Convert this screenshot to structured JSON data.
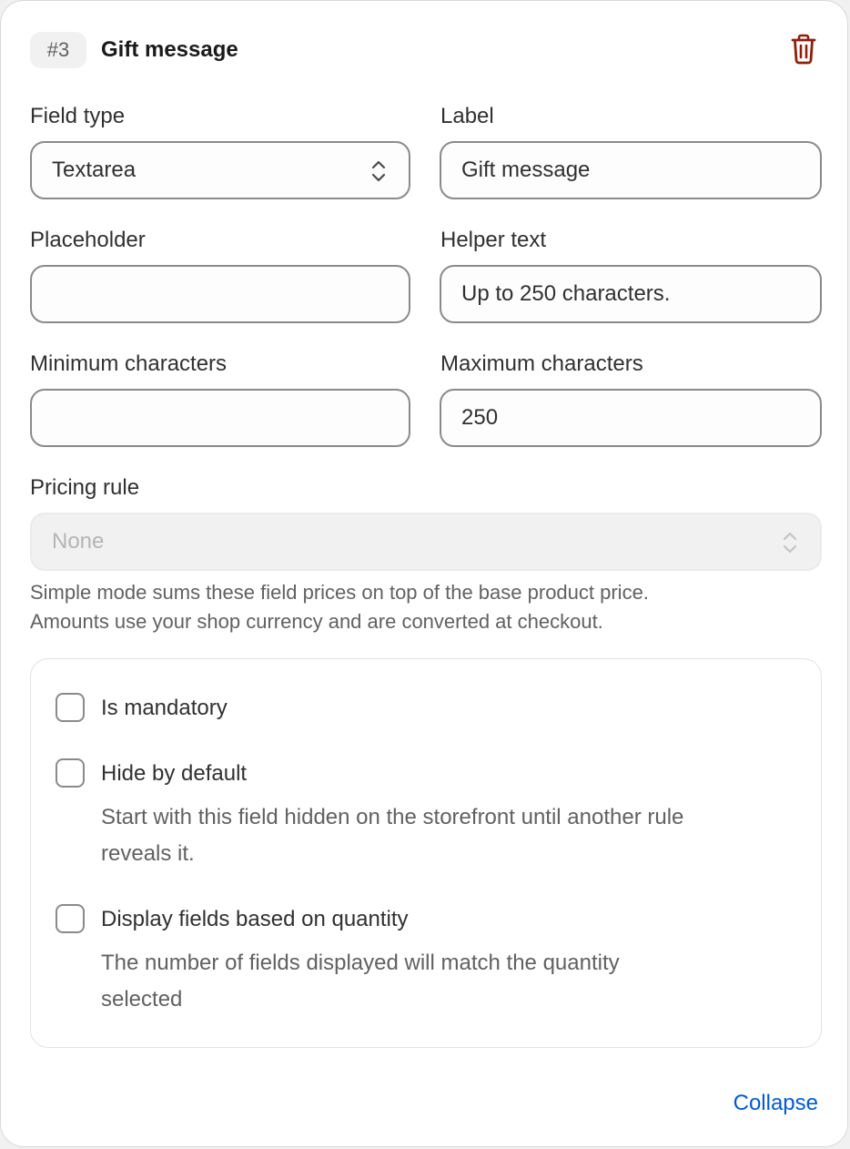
{
  "header": {
    "badge": "#3",
    "title": "Gift message",
    "delete_icon": "trash-icon",
    "delete_color": "#8e1f0b"
  },
  "fields": {
    "field_type": {
      "label": "Field type",
      "value": "Textarea"
    },
    "label": {
      "label": "Label",
      "value": "Gift message"
    },
    "placeholder": {
      "label": "Placeholder",
      "value": ""
    },
    "helper_text": {
      "label": "Helper text",
      "value": "Up to 250 characters."
    },
    "min_chars": {
      "label": "Minimum characters",
      "value": ""
    },
    "max_chars": {
      "label": "Maximum characters",
      "value": "250"
    }
  },
  "pricing": {
    "label": "Pricing rule",
    "value": "None",
    "help_line1": "Simple mode sums these field prices on top of the base product price.",
    "help_line2": "Amounts use your shop currency and are converted at checkout."
  },
  "options": [
    {
      "label": "Is mandatory",
      "help_lines": [],
      "checked": false
    },
    {
      "label": "Hide by default",
      "help_lines": [
        "Start with this field hidden on the storefront until another rule",
        "reveals it."
      ],
      "checked": false
    },
    {
      "label": "Display fields based on quantity",
      "help_lines": [
        "The number of fields displayed will match the quantity",
        "selected"
      ],
      "checked": false
    }
  ],
  "footer": {
    "collapse_label": "Collapse",
    "link_color": "#005bd3"
  }
}
